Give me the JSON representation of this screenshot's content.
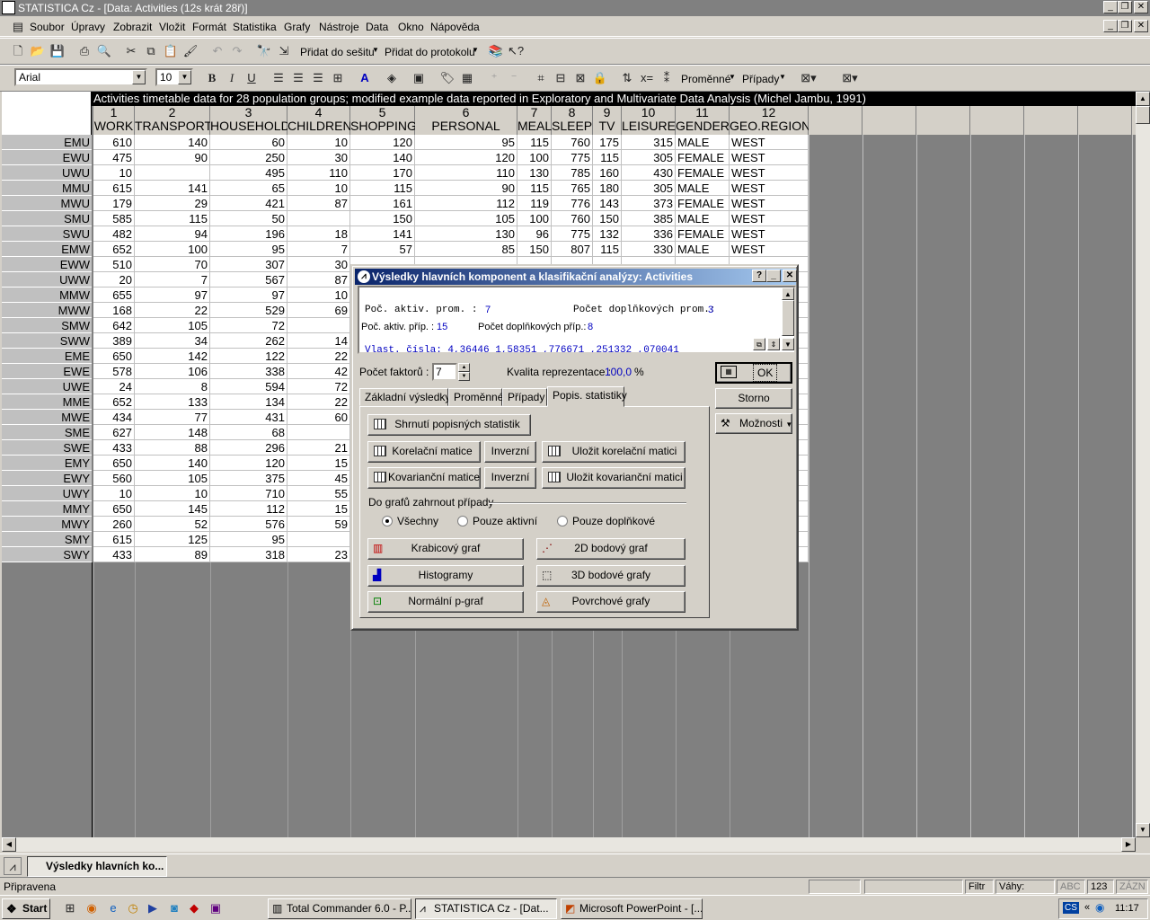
{
  "window": {
    "title": "STATISTICA Cz - [Data: Activities (12s krát 28ř)]"
  },
  "menu": [
    "Soubor",
    "Úpravy",
    "Zobrazit",
    "Vložit",
    "Formát",
    "Statistika",
    "Grafy",
    "Nástroje",
    "Data",
    "Okno",
    "Nápověda"
  ],
  "toolbar": {
    "add_workbook": "Přidat do sešitu",
    "add_report": "Přidat do protokolu"
  },
  "toolbar2": {
    "font": "Arial",
    "size": "10",
    "variables": "Proměnné",
    "cases": "Případy"
  },
  "sheet": {
    "title": "Activities timetable data for 28 population groups; modified example data reported in Exploratory and Multivariate Data Analysis (Michel Jambu, 1991)",
    "columns": [
      {
        "num": "1",
        "name": "WORK"
      },
      {
        "num": "2",
        "name": "TRANSPORT"
      },
      {
        "num": "3",
        "name": "HOUSEHOLD"
      },
      {
        "num": "4",
        "name": "CHILDREN"
      },
      {
        "num": "5",
        "name": "SHOPPING"
      },
      {
        "num": "6",
        "name": "PERSONAL CARE"
      },
      {
        "num": "7",
        "name": "MEAL"
      },
      {
        "num": "8",
        "name": "SLEEP"
      },
      {
        "num": "9",
        "name": "TV"
      },
      {
        "num": "10",
        "name": "LEISURE"
      },
      {
        "num": "11",
        "name": "GENDER"
      },
      {
        "num": "12",
        "name": "GEO.REGION"
      }
    ],
    "rows": [
      {
        "label": "EMU",
        "cells": [
          "610",
          "140",
          "60",
          "10",
          "120",
          "95",
          "115",
          "760",
          "175",
          "315",
          "MALE",
          "WEST"
        ]
      },
      {
        "label": "EWU",
        "cells": [
          "475",
          "90",
          "250",
          "30",
          "140",
          "120",
          "100",
          "775",
          "115",
          "305",
          "FEMALE",
          "WEST"
        ]
      },
      {
        "label": "UWU",
        "cells": [
          "10",
          "",
          "495",
          "110",
          "170",
          "110",
          "130",
          "785",
          "160",
          "430",
          "FEMALE",
          "WEST"
        ]
      },
      {
        "label": "MMU",
        "cells": [
          "615",
          "141",
          "65",
          "10",
          "115",
          "90",
          "115",
          "765",
          "180",
          "305",
          "MALE",
          "WEST"
        ]
      },
      {
        "label": "MWU",
        "cells": [
          "179",
          "29",
          "421",
          "87",
          "161",
          "112",
          "119",
          "776",
          "143",
          "373",
          "FEMALE",
          "WEST"
        ]
      },
      {
        "label": "SMU",
        "cells": [
          "585",
          "115",
          "50",
          "",
          "150",
          "105",
          "100",
          "760",
          "150",
          "385",
          "MALE",
          "WEST"
        ]
      },
      {
        "label": "SWU",
        "cells": [
          "482",
          "94",
          "196",
          "18",
          "141",
          "130",
          "96",
          "775",
          "132",
          "336",
          "FEMALE",
          "WEST"
        ]
      },
      {
        "label": "EMW",
        "cells": [
          "652",
          "100",
          "95",
          "7",
          "57",
          "85",
          "150",
          "807",
          "115",
          "330",
          "MALE",
          "WEST"
        ]
      },
      {
        "label": "EWW",
        "cells": [
          "510",
          "70",
          "307",
          "30"
        ]
      },
      {
        "label": "UWW",
        "cells": [
          "20",
          "7",
          "567",
          "87"
        ]
      },
      {
        "label": "MMW",
        "cells": [
          "655",
          "97",
          "97",
          "10"
        ]
      },
      {
        "label": "MWW",
        "cells": [
          "168",
          "22",
          "529",
          "69"
        ]
      },
      {
        "label": "SMW",
        "cells": [
          "642",
          "105",
          "72",
          ""
        ]
      },
      {
        "label": "SWW",
        "cells": [
          "389",
          "34",
          "262",
          "14"
        ]
      },
      {
        "label": "EME",
        "cells": [
          "650",
          "142",
          "122",
          "22"
        ]
      },
      {
        "label": "EWE",
        "cells": [
          "578",
          "106",
          "338",
          "42"
        ]
      },
      {
        "label": "UWE",
        "cells": [
          "24",
          "8",
          "594",
          "72"
        ]
      },
      {
        "label": "MME",
        "cells": [
          "652",
          "133",
          "134",
          "22"
        ]
      },
      {
        "label": "MWE",
        "cells": [
          "434",
          "77",
          "431",
          "60"
        ]
      },
      {
        "label": "SME",
        "cells": [
          "627",
          "148",
          "68",
          ""
        ]
      },
      {
        "label": "SWE",
        "cells": [
          "433",
          "88",
          "296",
          "21"
        ]
      },
      {
        "label": "EMY",
        "cells": [
          "650",
          "140",
          "120",
          "15"
        ]
      },
      {
        "label": "EWY",
        "cells": [
          "560",
          "105",
          "375",
          "45"
        ]
      },
      {
        "label": "UWY",
        "cells": [
          "10",
          "10",
          "710",
          "55"
        ]
      },
      {
        "label": "MMY",
        "cells": [
          "650",
          "145",
          "112",
          "15"
        ]
      },
      {
        "label": "MWY",
        "cells": [
          "260",
          "52",
          "576",
          "59"
        ]
      },
      {
        "label": "SMY",
        "cells": [
          "615",
          "125",
          "95",
          ""
        ]
      },
      {
        "label": "SWY",
        "cells": [
          "433",
          "89",
          "318",
          "23"
        ]
      }
    ]
  },
  "dialog": {
    "title": "Výsledky hlavních komponent a klasifikační analýzy: Activities",
    "summary": {
      "active_vars_label": "Poč. aktiv. prom. :",
      "active_vars": "7",
      "supp_vars_label": "Počet doplňkových prom.:",
      "supp_vars": "3",
      "active_cases_label": "Poč. aktiv. příp. :",
      "active_cases": "15",
      "supp_cases_label": "Počet doplňkových příp.:",
      "supp_cases": "8",
      "eigen_partial": "Vlast. čísla: 4,36446 1,58351 ,776671 ,251332 ,070041"
    },
    "factors_label": "Počet faktorů :",
    "factors_value": "7",
    "quality_label": "Kvalita reprezentace :",
    "quality_value": "100,0",
    "quality_unit": "%",
    "ok": "OK",
    "cancel": "Storno",
    "options": "Možnosti",
    "tabs": [
      "Základní výsledky",
      "Proměnné",
      "Případy",
      "Popis. statistiky"
    ],
    "buttons": {
      "summary": "Shrnutí popisných statistik",
      "corr": "Korelační matice",
      "inverse1": "Inverzní",
      "save_corr": "Uložit korelační matici",
      "cov": "Kovarianční matice",
      "inverse2": "Inverzní",
      "save_cov": "Uložit kovarianční matici"
    },
    "include_label": "Do grafů zahrnout případy",
    "radios": [
      "Všechny",
      "Pouze aktivní",
      "Pouze doplňkové"
    ],
    "graphs": {
      "box": "Krabicový graf",
      "scatter2d": "2D bodový graf",
      "hist": "Histogramy",
      "scatter3d": "3D bodové grafy",
      "normal": "Normální p-graf",
      "surface": "Povrchové grafy"
    }
  },
  "docbar": {
    "tab": "Výsledky hlavních ko..."
  },
  "status": {
    "ready": "Připravena",
    "filter": "Filtr -",
    "weights": "Váhy: VYPN",
    "abc": "ABC",
    "num": "123",
    "rec": "ZÁZN"
  },
  "taskbar": {
    "start": "Start",
    "tasks": [
      "Total Commander 6.0 - P...",
      "STATISTICA Cz - [Dat...",
      "Microsoft PowerPoint - [..."
    ],
    "lang": "CS",
    "clock": "11:17"
  }
}
